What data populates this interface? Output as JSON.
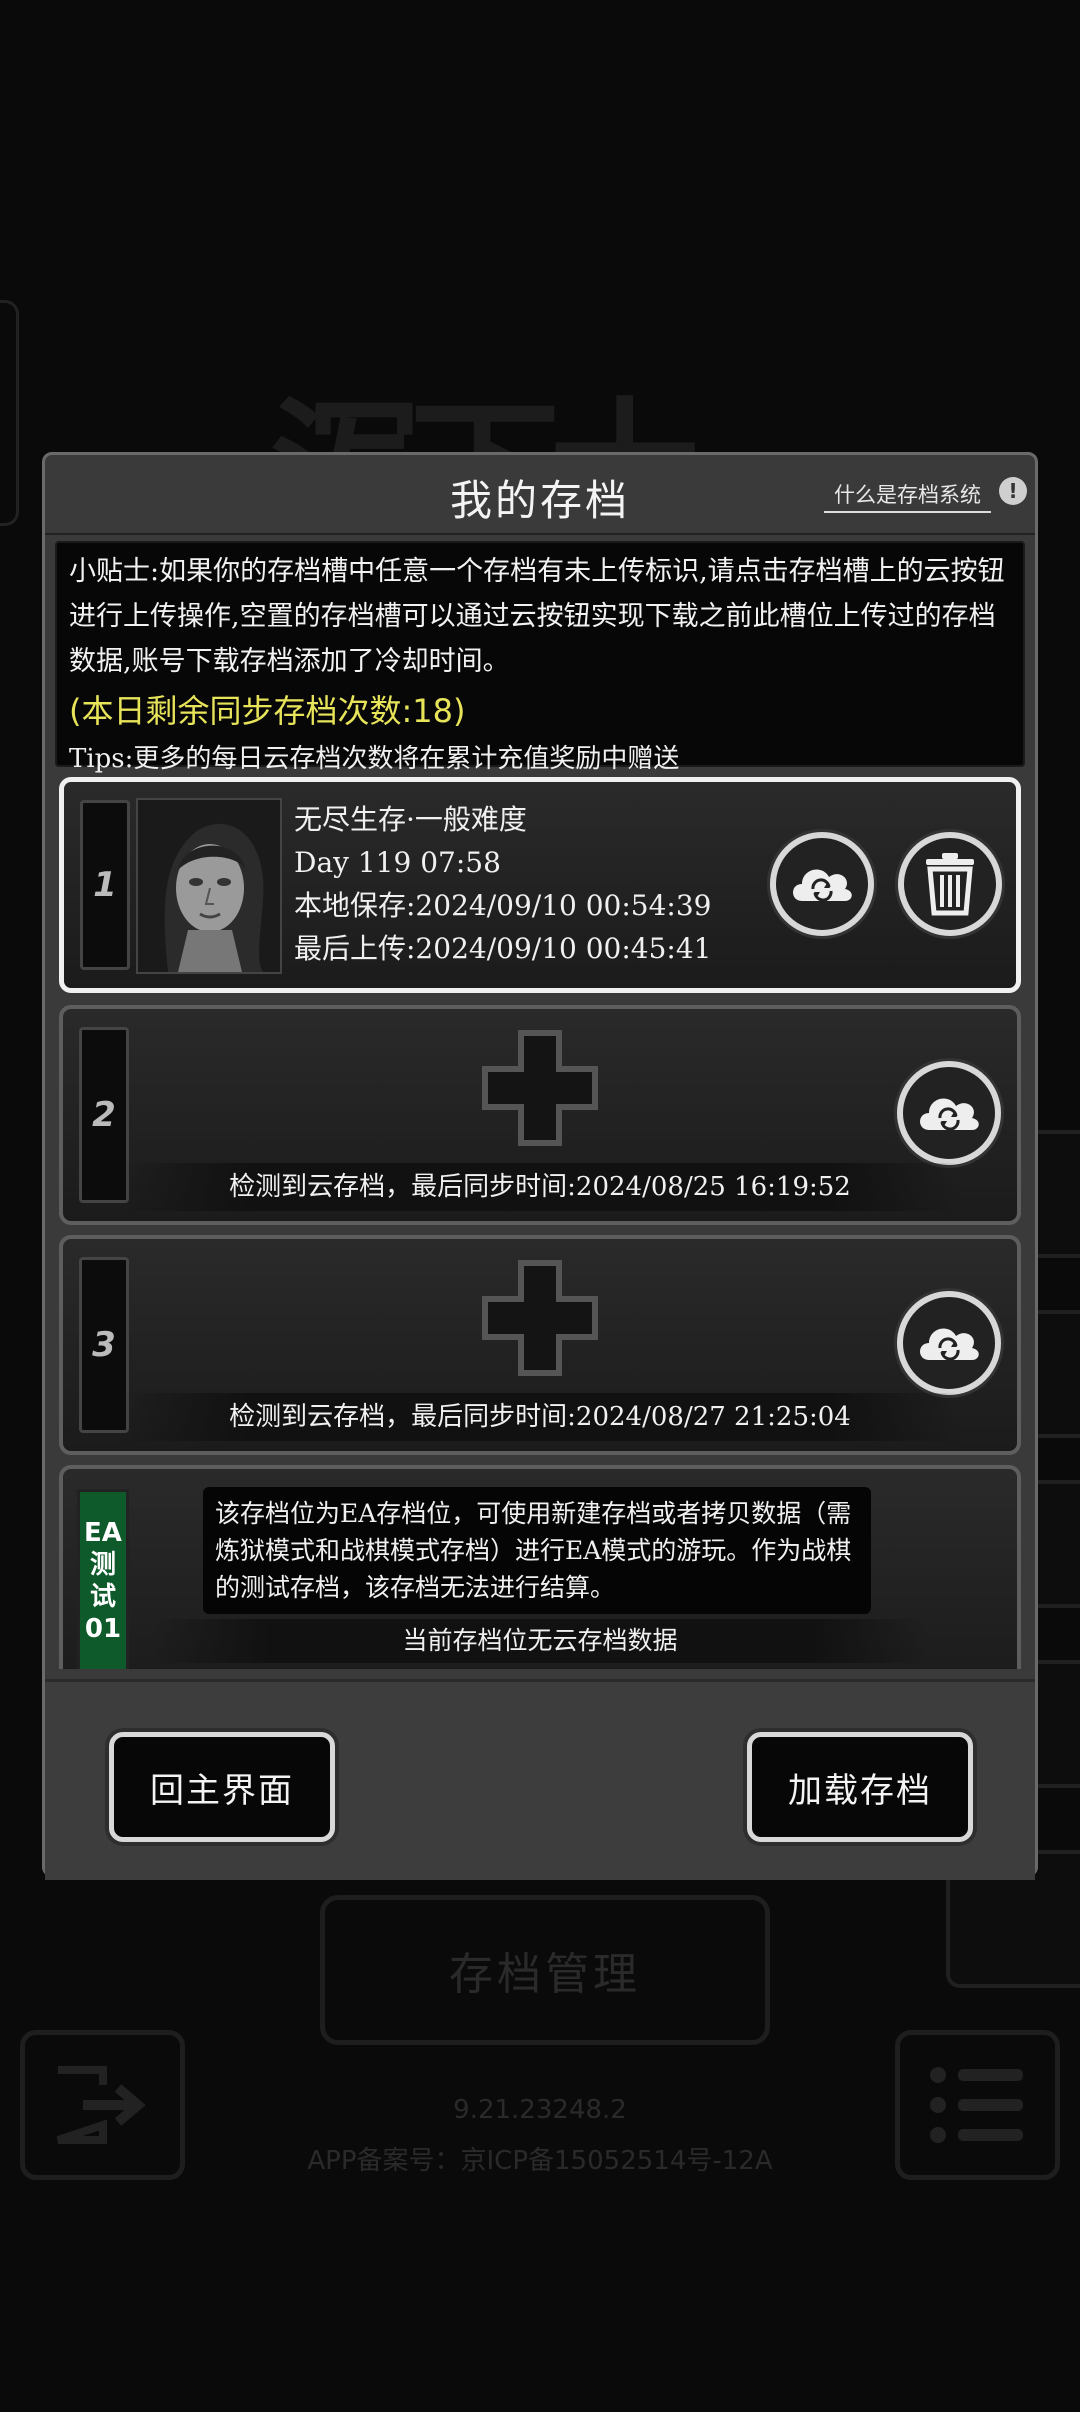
{
  "background": {
    "manage_label": "存档管理",
    "version": "9.21.23248.2",
    "icp": "APP备案号：京ICP备15052514号-12A"
  },
  "dialog": {
    "title": "我的存档",
    "help_link": "什么是存档系统",
    "help_icon": "!",
    "tips": {
      "main": "小贴士:如果你的存档槽中任意一个存档有未上传标识,请点击存档槽上的云按钮进行上传操作,空置的存档槽可以通过云按钮实现下载之前此槽位上传过的存档数据,账号下载存档添加了冷却时间。",
      "remaining": "(本日剩余同步存档次数:18)",
      "extra": "Tips:更多的每日云存档次数将在累计充值奖励中赠送"
    },
    "slots": [
      {
        "number": "1",
        "mode": "无尽生存·一般难度",
        "day": "Day 119  07:58",
        "local_save": "本地保存:2024/09/10  00:54:39",
        "last_upload": "最后上传:2024/09/10  00:45:41"
      },
      {
        "number": "2",
        "sync": "检测到云存档，最后同步时间:2024/08/25  16:19:52"
      },
      {
        "number": "3",
        "sync": "检测到云存档，最后同步时间:2024/08/27  21:25:04"
      }
    ],
    "ea_slot": {
      "label_line1": "EA",
      "label_line2": "测",
      "label_line3": "试",
      "label_line4": "01",
      "description": "该存档位为EA存档位，可使用新建存档或者拷贝数据（需炼狱模式和战棋模式存档）进行EA模式的游玩。作为战棋的测试存档，该存档无法进行结算。",
      "no_cloud": "当前存档位无云存档数据"
    },
    "buttons": {
      "home": "回主界面",
      "load": "加载存档"
    }
  },
  "icons": {
    "cloud": "cloud-sync-icon",
    "trash": "trash-icon",
    "plus": "plus-icon"
  }
}
